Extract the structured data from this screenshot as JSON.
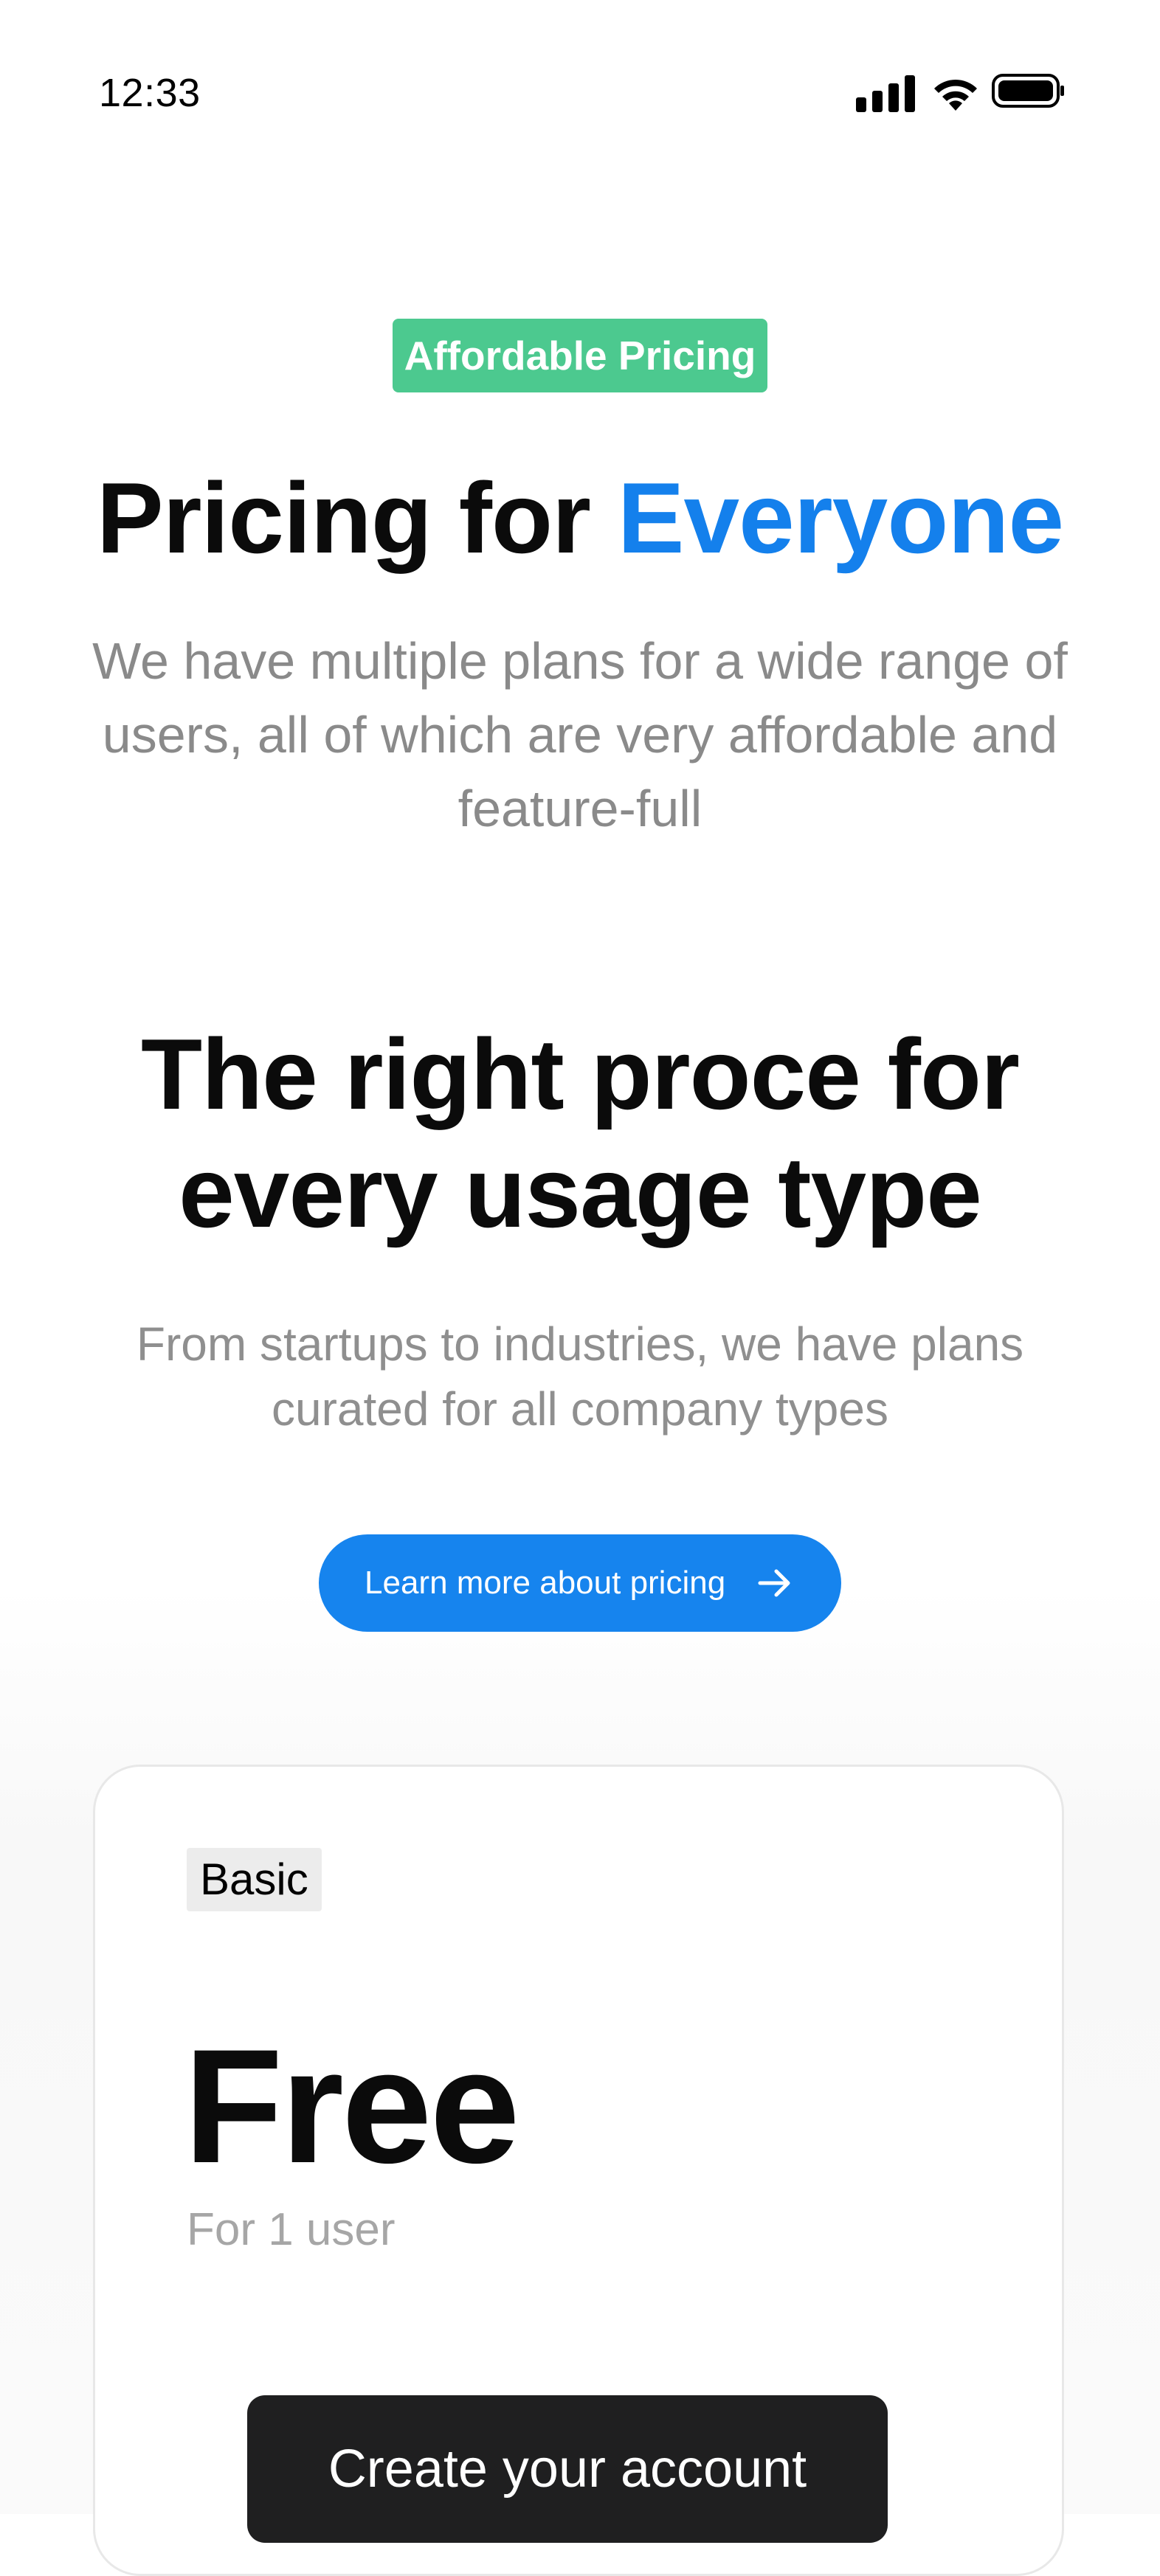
{
  "status_bar": {
    "time": "12:33",
    "icons": [
      "signal-icon",
      "wifi-icon",
      "battery-icon"
    ]
  },
  "hero": {
    "badge": "Affordable Pricing",
    "title_prefix": "Pricing for ",
    "title_accent": "Everyone",
    "subtitle": "We have multiple plans for a wide range of users, all of which are very affordable and feature-full"
  },
  "section": {
    "title": "The right proce for every usage type",
    "subtitle": "From startups to industries, we have plans curated for all company types",
    "cta_label": "Learn more about pricing",
    "cta_icon": "arrow-right-icon"
  },
  "plan": {
    "tag": "Basic",
    "price": "Free",
    "users": "For 1 user",
    "button_label": "Create your account"
  },
  "colors": {
    "badge": "#4cc98f",
    "accent": "#1480ec",
    "cta": "#1684ee",
    "dark_button": "#1f1f20",
    "muted_text": "#8a8a8a"
  }
}
